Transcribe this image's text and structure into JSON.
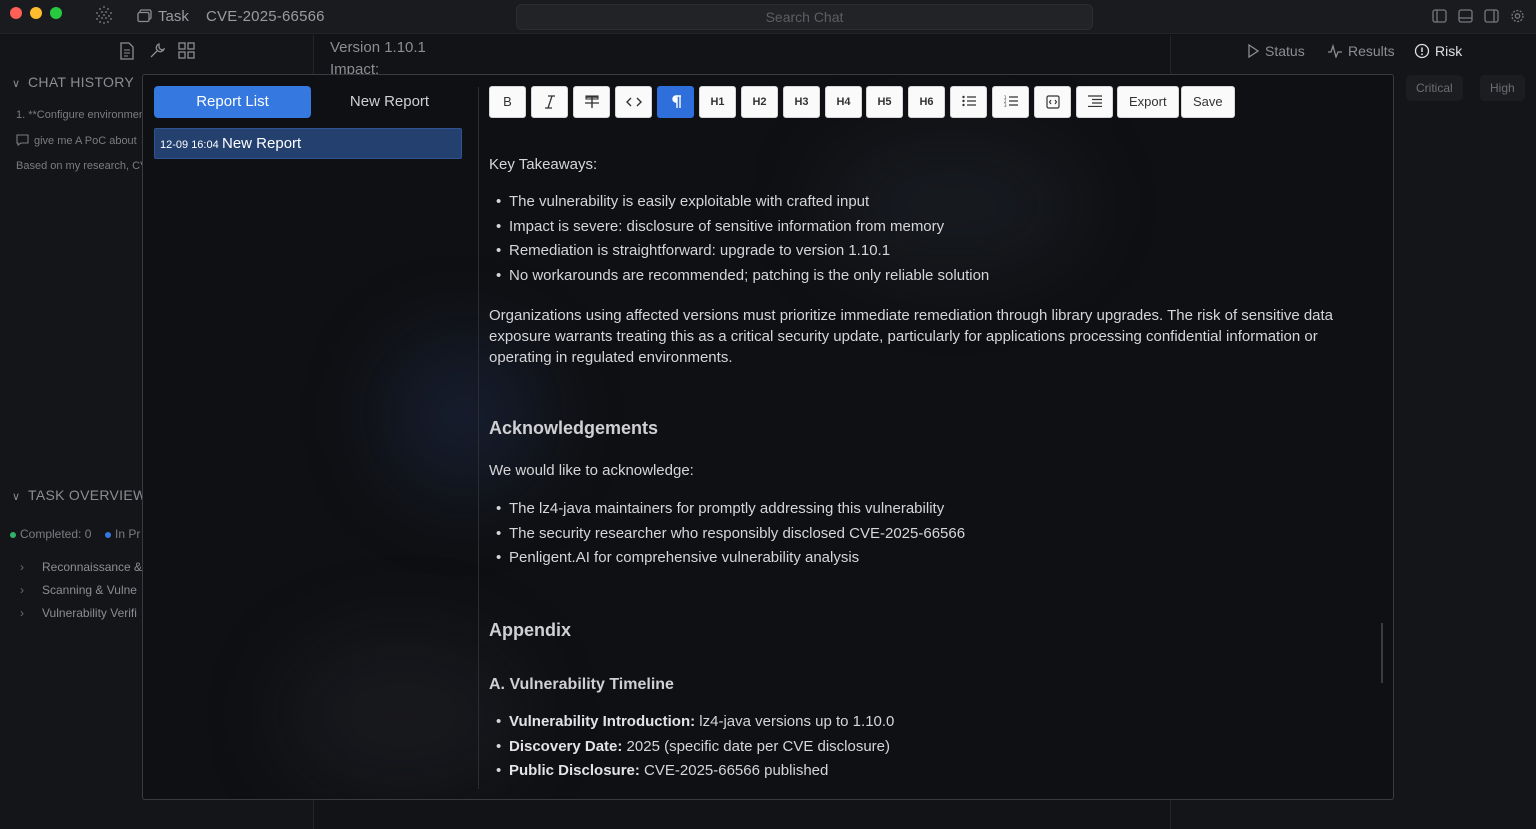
{
  "titlebar": {
    "task_label": "Task",
    "task_name": "CVE-2025-66566",
    "search_placeholder": "Search Chat"
  },
  "sidebar": {
    "chat_history_title": "CHAT HISTORY",
    "history": [
      "1. **Configure environmen",
      "give me A PoC about",
      "Based on my research, CV"
    ],
    "task_overview_title": "TASK OVERVIEW",
    "stats": {
      "completed": "Completed: 0",
      "in_progress": "In Pr"
    },
    "tree": [
      "Reconnaissance &",
      "Scanning & Vulne",
      "Vulnerability Verifi"
    ]
  },
  "middle": {
    "version": "Version 1.10.1",
    "impact": "Impact:"
  },
  "right_panel": {
    "tabs": [
      "Status",
      "Results",
      "Risk"
    ],
    "chips": [
      "Critical",
      "High"
    ]
  },
  "modal": {
    "tabs": {
      "report_list": "Report List",
      "new_report": "New Report"
    },
    "reports": [
      {
        "date": "12-09 16:04",
        "name": "New Report"
      }
    ],
    "toolbar": {
      "bold": "B",
      "h1": "H1",
      "h2": "H2",
      "h3": "H3",
      "h4": "H4",
      "h5": "H5",
      "h6": "H6",
      "export": "Export",
      "save": "Save"
    },
    "doc": {
      "key_takeaways": "Key Takeaways:",
      "takeaways": [
        "The vulnerability is easily exploitable with crafted input",
        "Impact is severe: disclosure of sensitive information from memory",
        "Remediation is straightforward: upgrade to version 1.10.1",
        "No workarounds are recommended; patching is the only reliable solution"
      ],
      "summary_lines": [
        "Organizations using affected versions must prioritize immediate remediation through library upgrades. The risk of sensitive data",
        "exposure warrants treating this as a critical security update, particularly for applications processing confidential information or",
        "operating in regulated environments."
      ],
      "ack_title": "Acknowledgements",
      "ack_intro": "We would like to acknowledge:",
      "acks": [
        "The lz4-java maintainers for promptly addressing this vulnerability",
        "The security researcher who responsibly disclosed CVE-2025-66566",
        "Penligent.AI for comprehensive vulnerability analysis"
      ],
      "appendix_title": "Appendix",
      "timeline_title": "A. Vulnerability Timeline",
      "timeline": [
        {
          "label": "Vulnerability Introduction:",
          "value": " lz4-java versions up to 1.10.0"
        },
        {
          "label": "Discovery Date:",
          "value": " 2025 (specific date per CVE disclosure)"
        },
        {
          "label": "Public Disclosure:",
          "value": " CVE-2025-66566 published"
        }
      ]
    }
  }
}
